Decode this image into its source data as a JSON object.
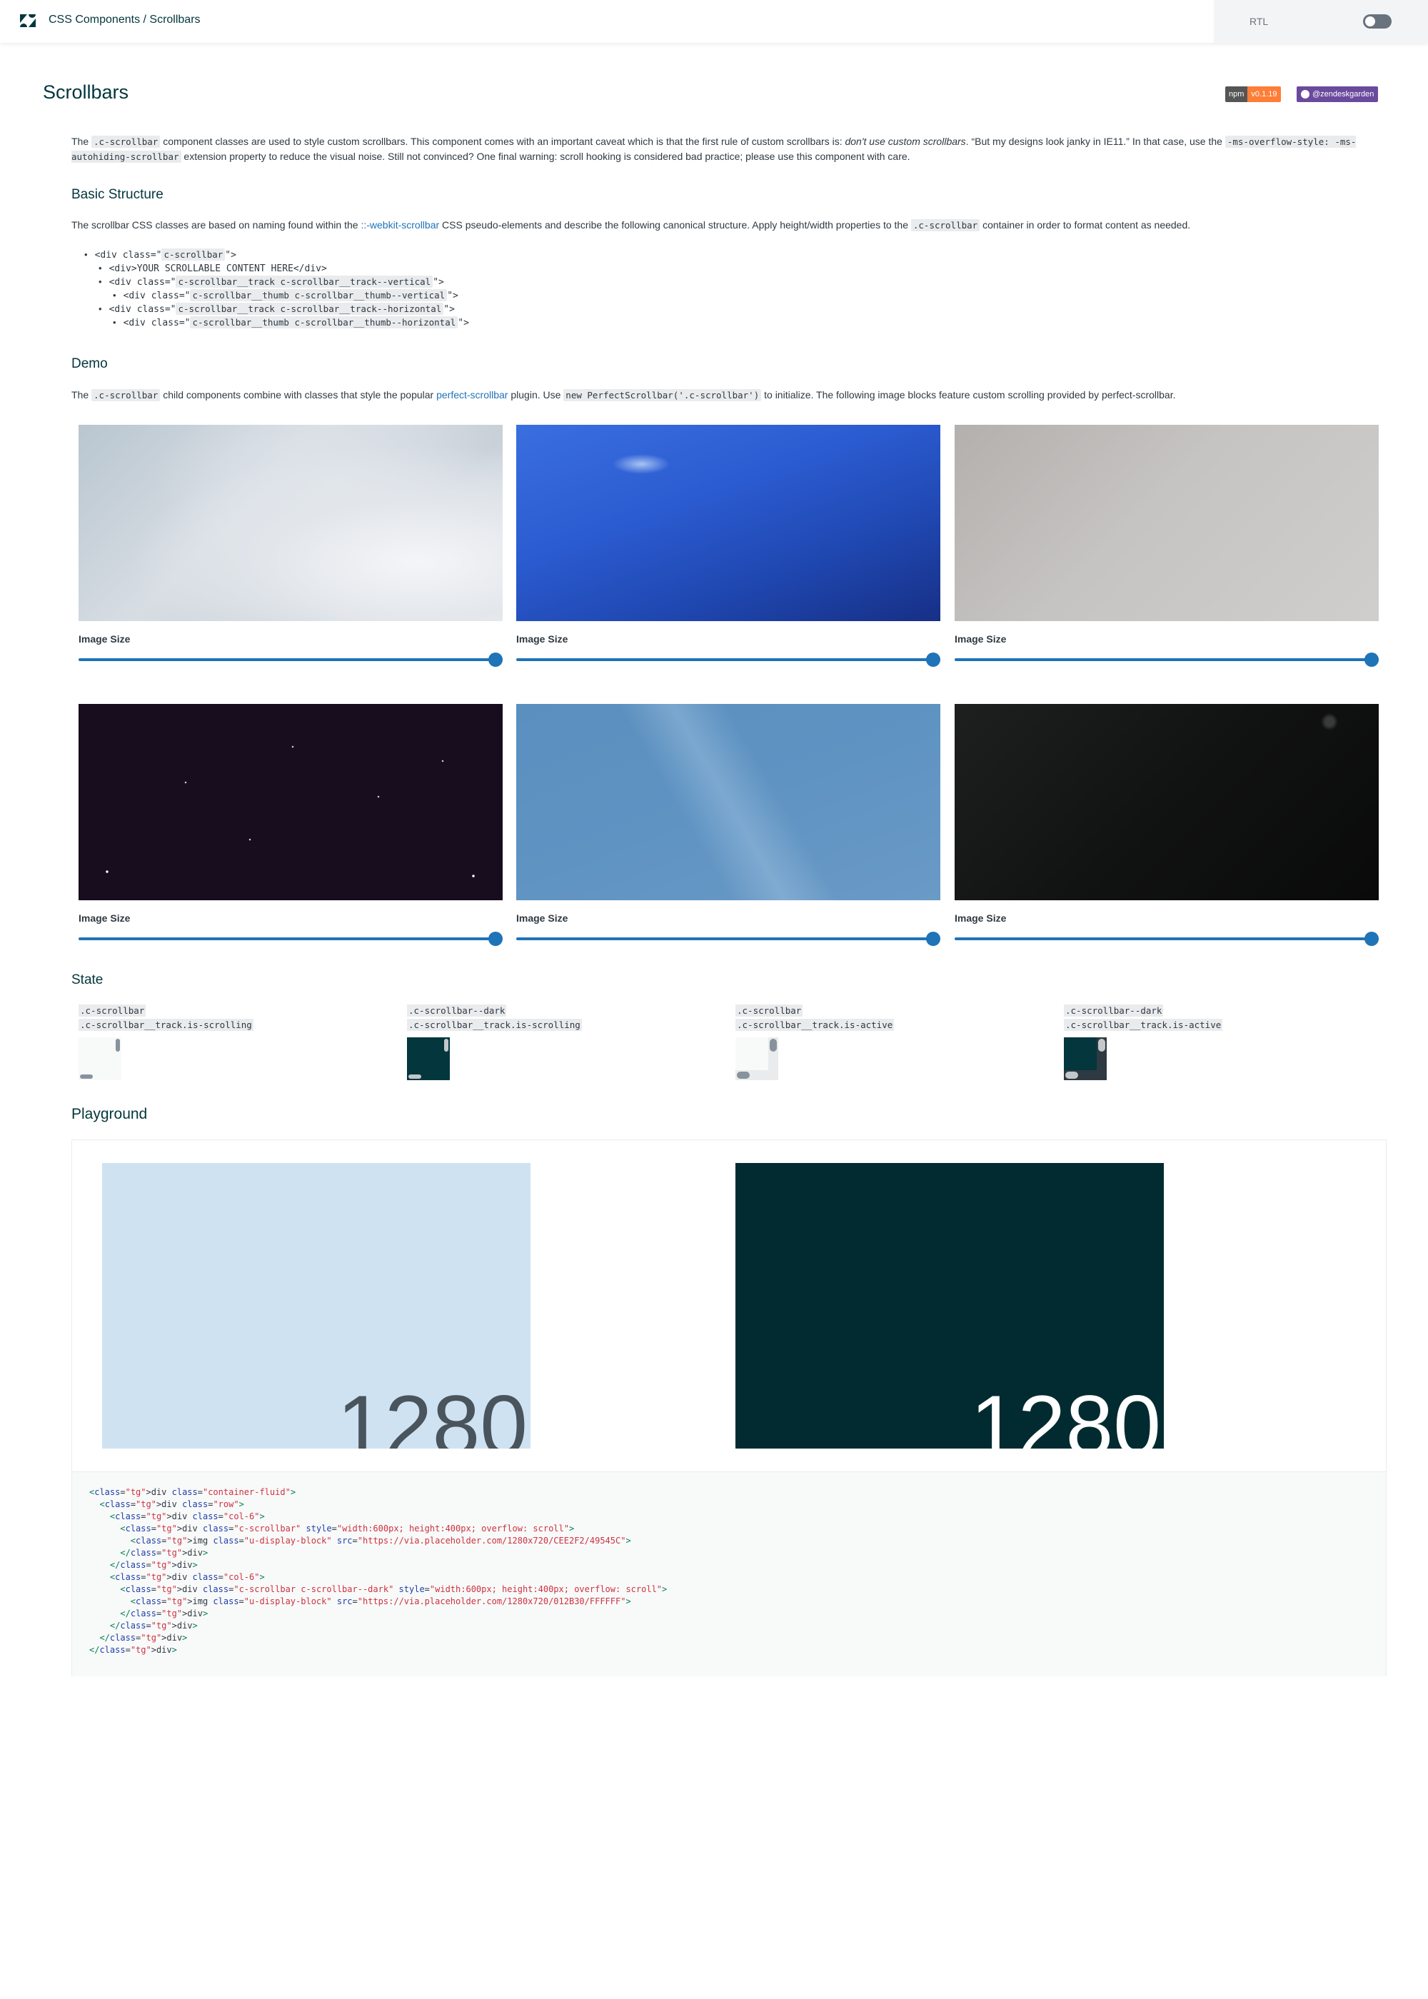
{
  "header": {
    "breadcrumb": "CSS Components / Scrollbars",
    "rtl_label": "RTL",
    "rtl_enabled": false
  },
  "page": {
    "title": "Scrollbars",
    "npm_badge": {
      "key": "npm",
      "version": "v0.1.19"
    },
    "github_badge": "@zendeskgarden"
  },
  "intro": {
    "p1_a": "The ",
    "p1_code": ".c-scrollbar",
    "p1_b": " component classes are used to style custom scrollbars. This component comes with an important caveat which is that the first rule of custom scrollbars is: ",
    "p1_em": "don't use custom scrollbars",
    "p1_c": ". “But my designs look janky in IE11.” In that case, use the ",
    "p1_code2": "-ms-overflow-style: -ms-autohiding-scrollbar",
    "p1_d": " extension property to reduce the visual noise. Still not convinced? One final warning: scroll hooking is considered bad practice; please use this component with care."
  },
  "basic": {
    "heading": "Basic Structure",
    "p_a": "The scrollbar CSS classes are based on naming found within the ",
    "p_link": "::-webkit-scrollbar",
    "p_b": " CSS pseudo-elements and describe the following canonical structure. Apply height/width properties to the ",
    "p_code": ".c-scrollbar",
    "p_c": " container in order to format content as needed.",
    "tree": [
      {
        "pre": "<div class=\"",
        "code": "c-scrollbar",
        "post": "\">",
        "level": 0
      },
      {
        "pre": "<div>YOUR SCROLLABLE CONTENT HERE</div>",
        "code": "",
        "post": "",
        "level": 1
      },
      {
        "pre": "<div class=\"",
        "code": "c-scrollbar__track c-scrollbar__track--vertical",
        "post": "\">",
        "level": 1
      },
      {
        "pre": "<div class=\"",
        "code": "c-scrollbar__thumb c-scrollbar__thumb--vertical",
        "post": "\">",
        "level": 2
      },
      {
        "pre": "<div class=\"",
        "code": "c-scrollbar__track c-scrollbar__track--horizontal",
        "post": "\">",
        "level": 1
      },
      {
        "pre": "<div class=\"",
        "code": "c-scrollbar__thumb c-scrollbar__thumb--horizontal",
        "post": "\">",
        "level": 2
      }
    ]
  },
  "demo": {
    "heading": "Demo",
    "p_a": "The ",
    "p_code": ".c-scrollbar",
    "p_b": " child components combine with classes that style the popular ",
    "p_link": "perfect-scrollbar",
    "p_c": " plugin. Use ",
    "p_code2": "new PerfectScrollbar('.c-scrollbar')",
    "p_d": " to initialize. The following image blocks feature custom scrolling provided by perfect-scrollbar.",
    "slider_label": "Image Size",
    "images": [
      {
        "name": "clouds-image",
        "slider_value": 1.0
      },
      {
        "name": "blue-sky-image",
        "slider_value": 1.0
      },
      {
        "name": "grey-sky-image",
        "slider_value": 1.0
      },
      {
        "name": "night-stars-image",
        "slider_value": 1.0
      },
      {
        "name": "light-blue-sky-image",
        "slider_value": 1.0
      },
      {
        "name": "dark-image",
        "slider_value": 1.0
      }
    ]
  },
  "state": {
    "heading": "State",
    "items": [
      {
        "line1": ".c-scrollbar",
        "line2": ".c-scrollbar__track.is-scrolling",
        "theme": "light"
      },
      {
        "line1": ".c-scrollbar--dark",
        "line2": ".c-scrollbar__track.is-scrolling",
        "theme": "dark"
      },
      {
        "line1": ".c-scrollbar",
        "line2": ".c-scrollbar__track.is-active",
        "theme": "light"
      },
      {
        "line1": ".c-scrollbar--dark",
        "line2": ".c-scrollbar__track.is-active",
        "theme": "dark"
      }
    ]
  },
  "playground": {
    "heading": "Playground",
    "light_number": "1280",
    "dark_number": "1280",
    "colors": {
      "light_bg": "#CEE2F2",
      "light_fg": "#49545C",
      "dark_bg": "#012B30",
      "dark_fg": "#FFFFFF"
    },
    "code_lines": [
      "<div class=\"container-fluid\">",
      "  <div class=\"row\">",
      "    <div class=\"col-6\">",
      "      <div class=\"c-scrollbar\" style=\"width:600px; height:400px; overflow: scroll\">",
      "        <img class=\"u-display-block\" src=\"https://via.placeholder.com/1280x720/CEE2F2/49545C\">",
      "      </div>",
      "    </div>",
      "    <div class=\"col-6\">",
      "      <div class=\"c-scrollbar c-scrollbar--dark\" style=\"width:600px; height:400px; overflow: scroll\">",
      "        <img class=\"u-display-block\" src=\"https://via.placeholder.com/1280x720/012B30/FFFFFF\">",
      "      </div>",
      "    </div>",
      "  </div>",
      "</div>"
    ]
  }
}
